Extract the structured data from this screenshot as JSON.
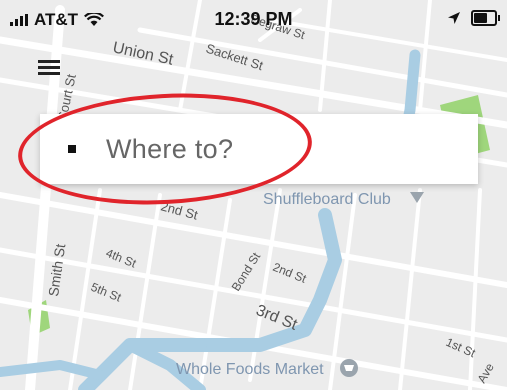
{
  "status_bar": {
    "carrier": "AT&T",
    "time": "12:39 PM"
  },
  "search": {
    "placeholder": "Where to?"
  },
  "map": {
    "streets": [
      {
        "label": "Union St"
      },
      {
        "label": "Sackett St"
      },
      {
        "label": "Degraw St"
      },
      {
        "label": "Court St"
      },
      {
        "label": "2nd St"
      },
      {
        "label": "4th St"
      },
      {
        "label": "5th St"
      },
      {
        "label": "Smith St"
      },
      {
        "label": "Bond St"
      },
      {
        "label": "2nd St"
      },
      {
        "label": "3rd St"
      },
      {
        "label": "1st St"
      },
      {
        "label": "Ave"
      }
    ],
    "places": [
      {
        "label": "Shuffleboard Club"
      },
      {
        "label": "Whole Foods Market"
      }
    ]
  },
  "colors": {
    "map_background": "#ececec",
    "street": "#ffffff",
    "water": "#a9cde3",
    "park": "#9fd67c",
    "annotation": "#e0242b",
    "place_label": "#7f96b0"
  }
}
